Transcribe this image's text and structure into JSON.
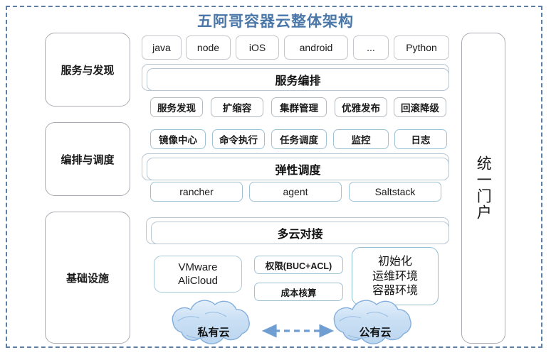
{
  "diagram": {
    "title": "五阿哥容器云整体架构",
    "title_color": "#4a77a8",
    "frame_color": "#5b7fa6"
  },
  "layers": [
    {
      "label": "服务与发现"
    },
    {
      "label": "编排与调度"
    },
    {
      "label": "基础设施"
    }
  ],
  "portal": {
    "label": "统一门户"
  },
  "service_layer": {
    "languages": [
      "java",
      "node",
      "iOS",
      "android",
      "...",
      "Python"
    ],
    "banner": "服务编排",
    "capabilities": [
      "服务发现",
      "扩缩容",
      "集群管理",
      "优雅发布",
      "回滚降级"
    ]
  },
  "orchestration_layer": {
    "capabilities": [
      "镜像中心",
      "命令执行",
      "任务调度",
      "监控",
      "日志"
    ],
    "banner": "弹性调度",
    "tools": [
      "rancher",
      "agent",
      "Saltstack"
    ]
  },
  "infrastructure_layer": {
    "banner": "多云对接",
    "vendor_box": {
      "line1": "VMware",
      "line2": "AliCloud"
    },
    "governance": [
      "权限(BUC+ACL)",
      "成本核算"
    ],
    "environment_box": {
      "line1": "初始化",
      "line2": "运维环境",
      "line3": "容器环境"
    }
  },
  "clouds": {
    "private": "私有云",
    "public": "公有云",
    "connector": "双向虚线箭头",
    "fill_color": "#c6dcf0",
    "stroke_color": "#7ba7d7"
  }
}
